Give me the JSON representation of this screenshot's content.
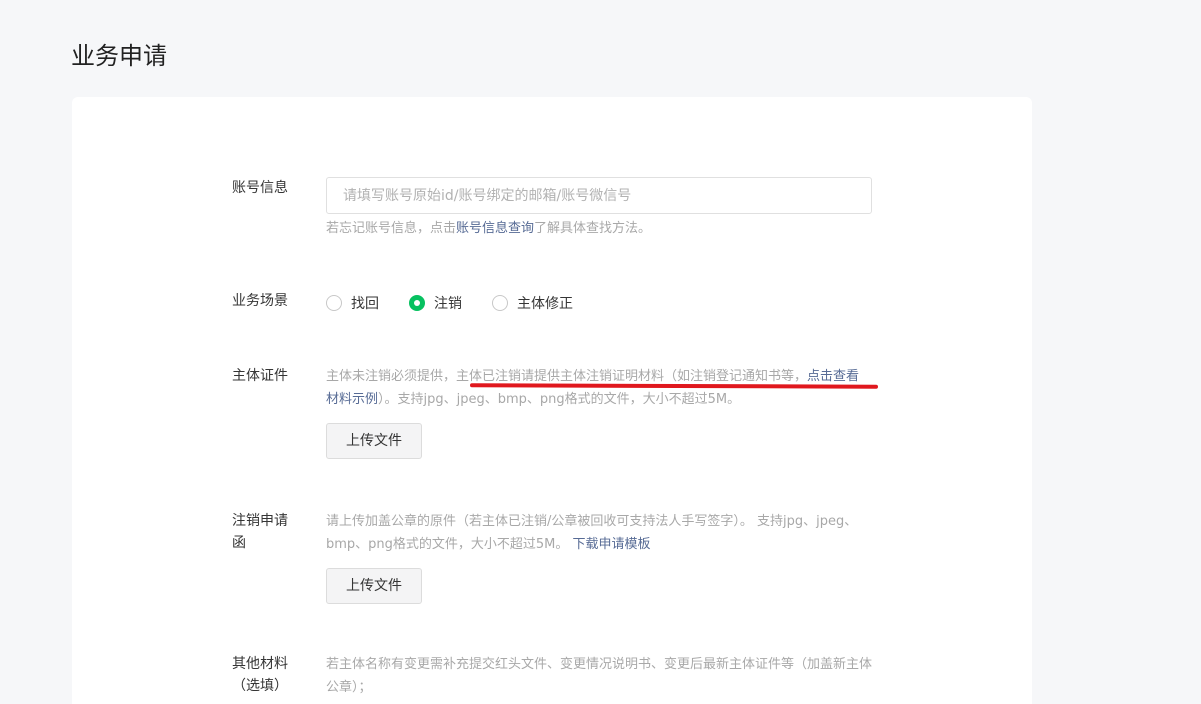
{
  "page": {
    "title": "业务申请"
  },
  "account": {
    "label": "账号信息",
    "placeholder": "请填写账号原始id/账号绑定的邮箱/账号微信号",
    "hint_prefix": "若忘记账号信息，点击",
    "hint_link": "账号信息查询",
    "hint_suffix": "了解具体查找方法。"
  },
  "scenario": {
    "label": "业务场景",
    "options": [
      {
        "label": "找回",
        "checked": false
      },
      {
        "label": "注销",
        "checked": true
      },
      {
        "label": "主体修正",
        "checked": false
      }
    ]
  },
  "certificate": {
    "label": "主体证件",
    "desc_part1": "主体未注销必须提供，",
    "desc_part2": "主体已注销请提供主体注销证明材料（如注销登记通知书等，",
    "desc_link": "点击查看材料示例",
    "desc_part3": "）。支持jpg、jpeg、bmp、png格式的文件，大小不超过5M。",
    "upload_label": "上传文件"
  },
  "cancel_letter": {
    "label": "注销申请函",
    "desc": "请上传加盖公章的原件（若主体已注销/公章被回收可支持法人手写签字）。 支持jpg、jpeg、bmp、png格式的文件，大小不超过5M。 ",
    "desc_link": "下载申请模板",
    "upload_label": "上传文件"
  },
  "other": {
    "label": "其他材料（选填）",
    "desc": "若主体名称有变更需补充提交红头文件、变更情况说明书、变更后最新主体证件等（加盖新主体公章）；"
  },
  "colors": {
    "accent": "#07c160",
    "link": "#576b95",
    "annotation": "#e0181e"
  }
}
